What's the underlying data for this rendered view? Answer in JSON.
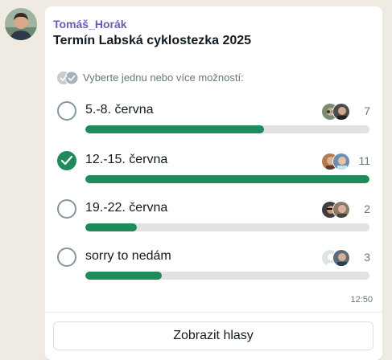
{
  "message": {
    "sender": "Tomáš_Horák",
    "time": "12:50"
  },
  "poll": {
    "question": "Termín Labská cyklostezka 2025",
    "hint": "Vyberte jednu nebo více možností:",
    "options": [
      {
        "label": "5.-8. června",
        "votes": "7",
        "fill_fraction": 0.63,
        "selected": false,
        "voter_icons": [
          "voter-avatar-icon",
          "voter-avatar-icon"
        ]
      },
      {
        "label": "12.-15. června",
        "votes": "11",
        "fill_fraction": 1.0,
        "selected": true,
        "voter_icons": [
          "voter-avatar-icon",
          "voter-avatar-icon"
        ]
      },
      {
        "label": "19.-22. června",
        "votes": "2",
        "fill_fraction": 0.18,
        "selected": false,
        "voter_icons": [
          "voter-avatar-icon",
          "voter-avatar-icon"
        ]
      },
      {
        "label": "sorry to nedám",
        "votes": "3",
        "fill_fraction": 0.27,
        "selected": false,
        "voter_icons": [
          "default-avatar-icon",
          "voter-avatar-icon"
        ]
      }
    ],
    "view_votes_label": "Zobrazit hlasy"
  },
  "colors": {
    "accent": "#1f8a5a",
    "sender_name": "#6b5bb3",
    "wallpaper": "#efeae2"
  }
}
